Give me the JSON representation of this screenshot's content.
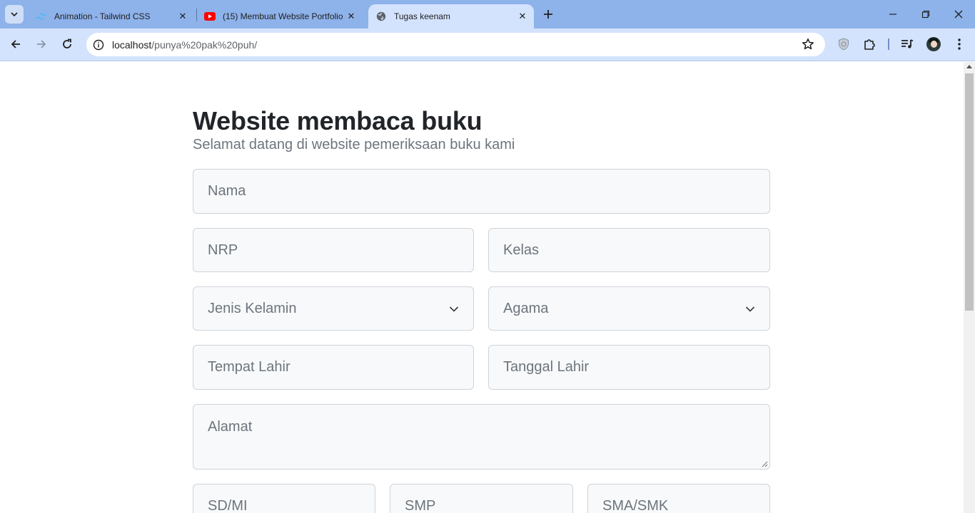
{
  "browser": {
    "tabs": [
      {
        "title": "Animation - Tailwind CSS",
        "favicon": "tailwind-icon",
        "active": false
      },
      {
        "title": "(15) Membuat Website Portfolio",
        "favicon": "youtube-icon",
        "active": false
      },
      {
        "title": "Tugas keenam",
        "favicon": "globe-icon",
        "active": true
      }
    ],
    "address": {
      "host": "localhost",
      "path": "/punya%20pak%20puh/"
    }
  },
  "page": {
    "title": "Website membaca buku",
    "subtitle": "Selamat datang di website pemeriksaan buku kami",
    "form": {
      "nama": "Nama",
      "nrp": "NRP",
      "kelas": "Kelas",
      "jenis_kelamin": "Jenis Kelamin",
      "agama": "Agama",
      "tempat_lahir": "Tempat Lahir",
      "tanggal_lahir": "Tanggal Lahir",
      "alamat": "Alamat",
      "sd": "SD/MI",
      "smp": "SMP",
      "sma": "SMA/SMK"
    }
  },
  "colors": {
    "tabbar": "#8eb2ea",
    "toolbar": "#d3e3fd",
    "field_bg": "#f8f9fa",
    "field_border": "#ced4da",
    "placeholder": "#6c757d",
    "title": "#212529"
  }
}
